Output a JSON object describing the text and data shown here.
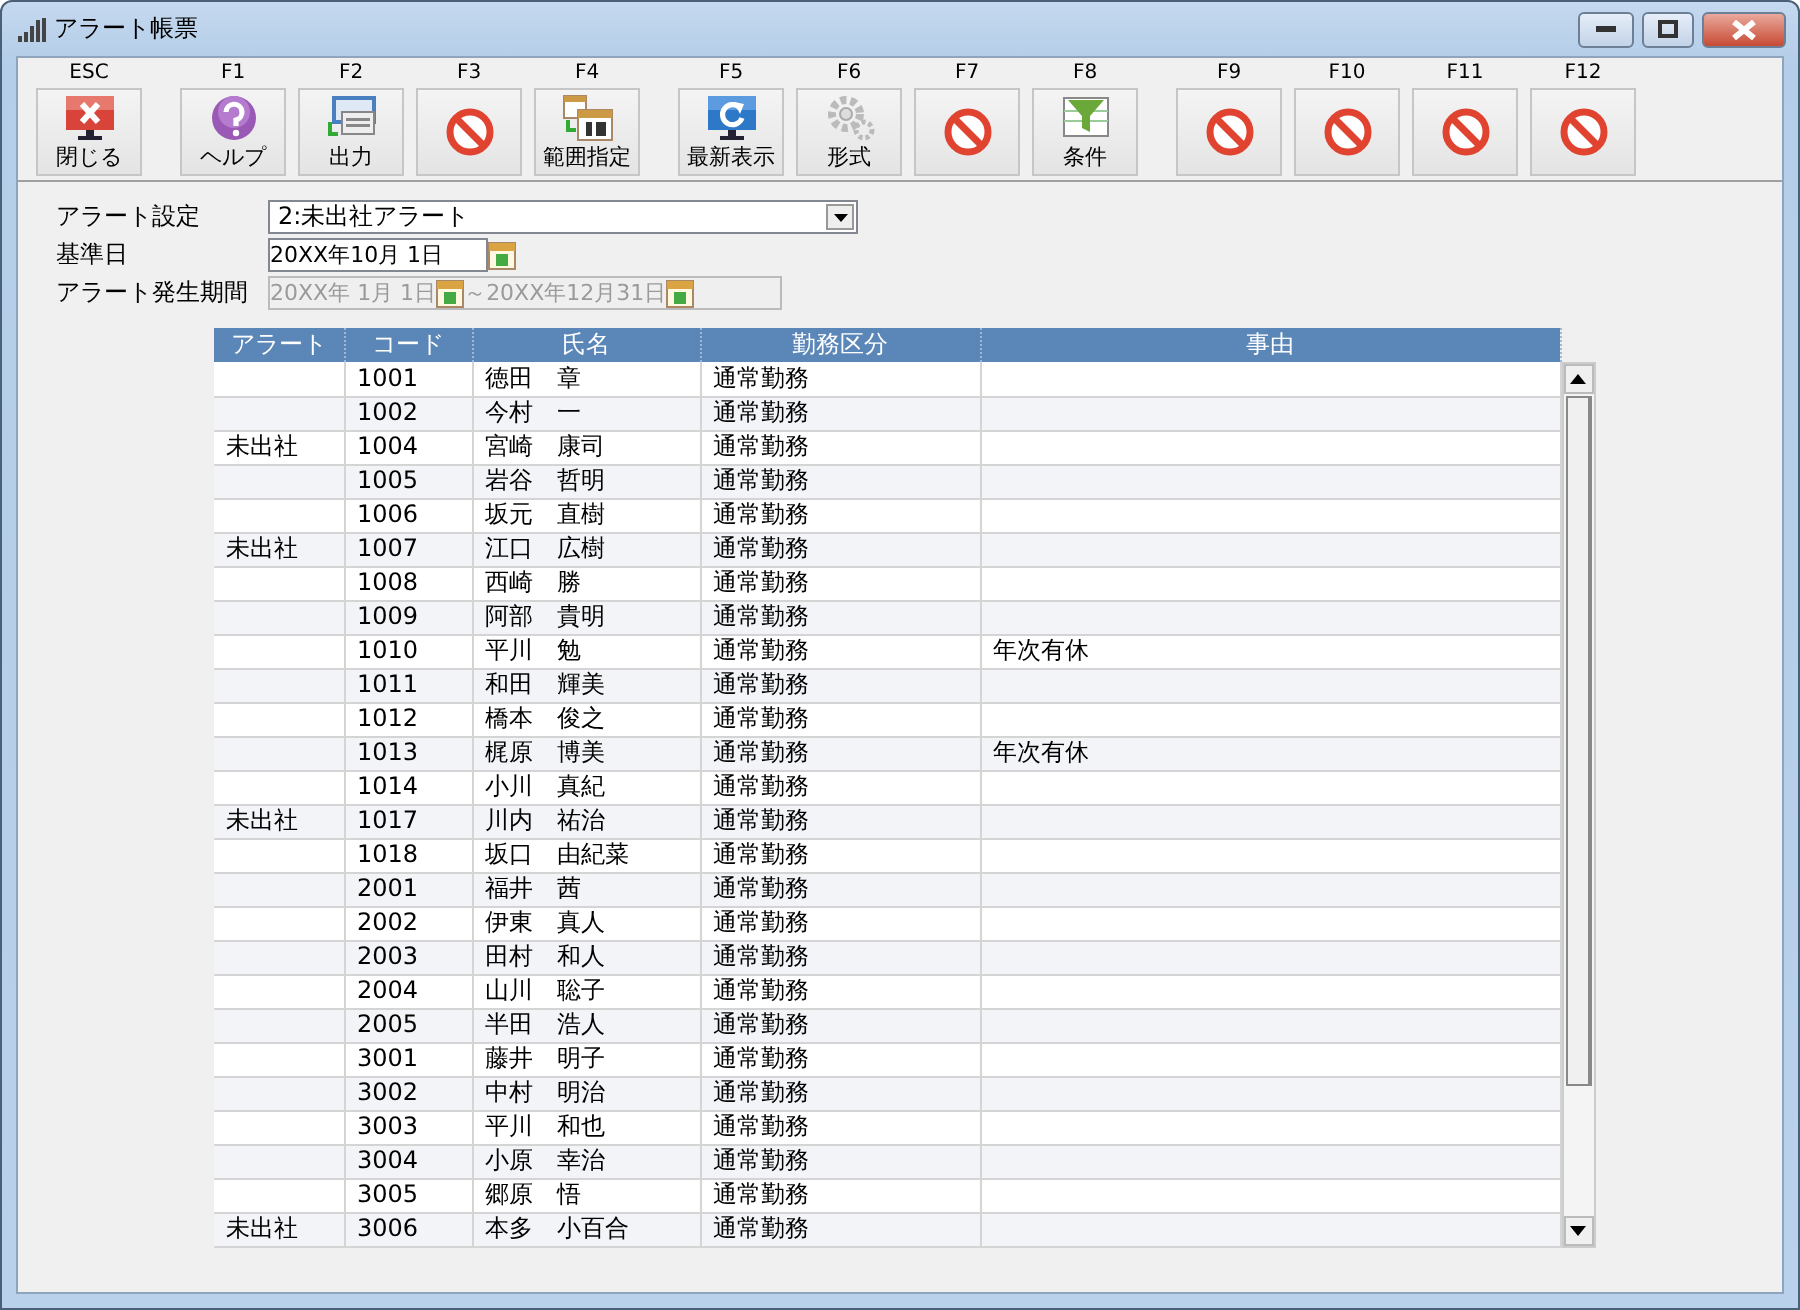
{
  "window": {
    "title": "アラート帳票"
  },
  "toolbar": {
    "groups": [
      [
        {
          "key": "ESC",
          "kind": "close",
          "label": "閉じる"
        }
      ],
      [
        {
          "key": "F1",
          "kind": "help",
          "label": "ヘルプ"
        },
        {
          "key": "F2",
          "kind": "output",
          "label": "出力"
        },
        {
          "key": "F3",
          "kind": "unavailable"
        },
        {
          "key": "F4",
          "kind": "calendar",
          "label": "範囲指定"
        }
      ],
      [
        {
          "key": "F5",
          "kind": "refresh",
          "label": "最新表示"
        },
        {
          "key": "F6",
          "kind": "gear",
          "label": "形式"
        },
        {
          "key": "F7",
          "kind": "unavailable"
        },
        {
          "key": "F8",
          "kind": "filter",
          "label": "条件"
        }
      ],
      [
        {
          "key": "F9",
          "kind": "unavailable"
        },
        {
          "key": "F10",
          "kind": "unavailable"
        },
        {
          "key": "F11",
          "kind": "unavailable"
        },
        {
          "key": "F12",
          "kind": "unavailable"
        }
      ]
    ]
  },
  "form": {
    "alert_setting": {
      "label": "アラート設定",
      "value": "2:未出社アラート"
    },
    "base_date": {
      "label": "基準日",
      "value": "20XX年10月 1日"
    },
    "period": {
      "label": "アラート発生期間",
      "from": "20XX年 1月 1日",
      "to": "～20XX年12月31日",
      "disabled": true
    }
  },
  "table": {
    "columns": [
      "アラート",
      "コード",
      "氏名",
      "勤務区分",
      "事由"
    ],
    "rows": [
      {
        "code": "1001",
        "name": "徳田　章",
        "type": "通常勤務"
      },
      {
        "code": "1002",
        "name": "今村　一",
        "type": "通常勤務"
      },
      {
        "alert": "未出社",
        "code": "1004",
        "name": "宮崎　康司",
        "type": "通常勤務"
      },
      {
        "code": "1005",
        "name": "岩谷　哲明",
        "type": "通常勤務"
      },
      {
        "code": "1006",
        "name": "坂元　直樹",
        "type": "通常勤務"
      },
      {
        "alert": "未出社",
        "code": "1007",
        "name": "江口　広樹",
        "type": "通常勤務"
      },
      {
        "code": "1008",
        "name": "西崎　勝",
        "type": "通常勤務"
      },
      {
        "code": "1009",
        "name": "阿部　貴明",
        "type": "通常勤務"
      },
      {
        "code": "1010",
        "name": "平川　勉",
        "type": "通常勤務",
        "reason": "年次有休"
      },
      {
        "code": "1011",
        "name": "和田　輝美",
        "type": "通常勤務"
      },
      {
        "code": "1012",
        "name": "橋本　俊之",
        "type": "通常勤務"
      },
      {
        "code": "1013",
        "name": "梶原　博美",
        "type": "通常勤務",
        "reason": "年次有休"
      },
      {
        "code": "1014",
        "name": "小川　真紀",
        "type": "通常勤務"
      },
      {
        "alert": "未出社",
        "code": "1017",
        "name": "川内　祐治",
        "type": "通常勤務"
      },
      {
        "code": "1018",
        "name": "坂口　由紀菜",
        "type": "通常勤務"
      },
      {
        "code": "2001",
        "name": "福井　茜",
        "type": "通常勤務"
      },
      {
        "code": "2002",
        "name": "伊東　真人",
        "type": "通常勤務"
      },
      {
        "code": "2003",
        "name": "田村　和人",
        "type": "通常勤務"
      },
      {
        "code": "2004",
        "name": "山川　聡子",
        "type": "通常勤務"
      },
      {
        "code": "2005",
        "name": "半田　浩人",
        "type": "通常勤務"
      },
      {
        "code": "3001",
        "name": "藤井　明子",
        "type": "通常勤務"
      },
      {
        "code": "3002",
        "name": "中村　明治",
        "type": "通常勤務"
      },
      {
        "code": "3003",
        "name": "平川　和也",
        "type": "通常勤務"
      },
      {
        "code": "3004",
        "name": "小原　幸治",
        "type": "通常勤務"
      },
      {
        "code": "3005",
        "name": "郷原　悟",
        "type": "通常勤務"
      },
      {
        "alert": "未出社",
        "code": "3006",
        "name": "本多　小百合",
        "type": "通常勤務"
      }
    ]
  }
}
